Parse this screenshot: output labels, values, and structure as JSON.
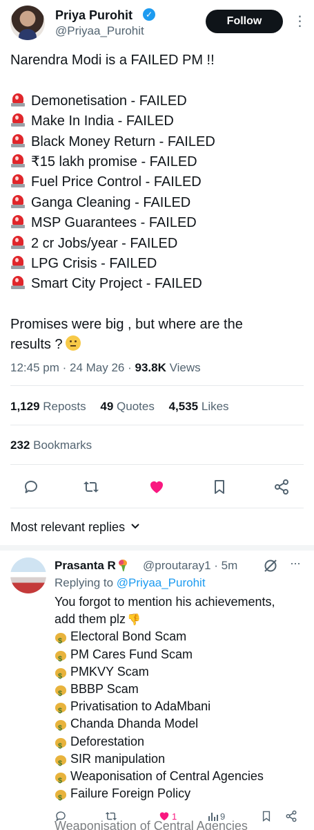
{
  "author": {
    "name": "Priya Purohit",
    "handle": "@Priyaa_Purohit",
    "follow_label": "Follow"
  },
  "tweet": {
    "headline": "Narendra Modi is a FAILED PM !!",
    "items": [
      "Demonetisation - FAILED",
      "Make In India - FAILED",
      "Black Money Return - FAILED",
      "₹15 lakh promise - FAILED",
      "Fuel Price Control - FAILED",
      "Ganga Cleaning - FAILED",
      "MSP Guarantees - FAILED",
      "2 cr Jobs/year - FAILED",
      "LPG Crisis - FAILED",
      "Smart City Project - FAILED"
    ],
    "closing_line1": "Promises were big , but where are the",
    "closing_line2": "results ?",
    "item_icon": "police-siren-icon",
    "closing_icon": "thinking-face-icon"
  },
  "meta": {
    "time_date": "12:45 pm · 24 May 26 · ",
    "views_count": "93.8K",
    "views_label": " Views"
  },
  "stats": {
    "reposts_count": "1,129",
    "reposts_label": "Reposts",
    "quotes_count": "49",
    "quotes_label": "Quotes",
    "likes_count": "4,535",
    "likes_label": "Likes",
    "bookmarks_count": "232",
    "bookmarks_label": "Bookmarks"
  },
  "actions": {
    "icons": [
      "reply-icon",
      "repost-icon",
      "like-icon",
      "bookmark-icon",
      "share-icon"
    ],
    "like_color": "#f91880"
  },
  "sort": {
    "label": "Most relevant replies"
  },
  "reply": {
    "name": "Prasanta R",
    "handle_time": "@proutaray1 · 5m",
    "replying_prefix": "Replying to ",
    "replying_to": "@Priyaa_Purohit",
    "intro_line1": "You forgot to mention his achievements,",
    "intro_line2": "add them plz",
    "items": [
      "Electoral Bond Scam",
      "PM Cares Fund Scam",
      "PMKVY Scam",
      "BBBP Scam",
      "Privatisation to AdaMbani",
      "Chanda Dhanda Model",
      "Deforestation",
      "SIR manipulation",
      "Weaponisation of Central Agencies",
      "Failure Foreign Policy"
    ],
    "item_icon": "money-bag-icon",
    "likes": "1",
    "views": "9",
    "cutoff_text": "Weaponisation of Central Agencies"
  },
  "colors": {
    "accent": "#1d9bf0",
    "like": "#f91880",
    "text": "#0f1419",
    "secondary": "#536471"
  }
}
